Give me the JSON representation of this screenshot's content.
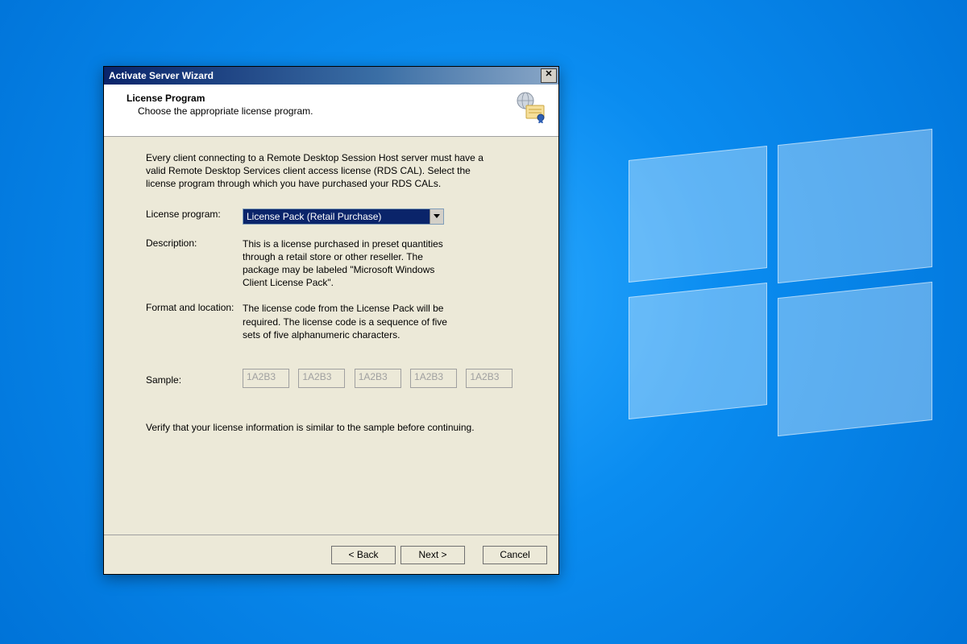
{
  "titlebar": {
    "title": "Activate Server Wizard",
    "close_glyph": "✕"
  },
  "header": {
    "heading": "License Program",
    "subheading": "Choose the appropriate license program."
  },
  "body": {
    "intro": "Every client connecting to a Remote Desktop Session Host server must have a valid Remote Desktop Services client access license (RDS CAL). Select the license program through which you have purchased your RDS CALs.",
    "license_program_label": "License program:",
    "license_program_value": "License Pack (Retail Purchase)",
    "description_label": "Description:",
    "description_value": "This is a license purchased in preset quantities through a retail store or other reseller. The package may be labeled \"Microsoft Windows Client License Pack\".",
    "format_label": "Format and location:",
    "format_value": "The license code from the License Pack will be required. The license code is a sequence of five sets of five alphanumeric characters.",
    "sample_label": "Sample:",
    "sample_placeholders": [
      "1A2B3",
      "1A2B3",
      "1A2B3",
      "1A2B3",
      "1A2B3"
    ],
    "verify_text": "Verify that your license information is similar to the sample before continuing."
  },
  "footer": {
    "back": "< Back",
    "next": "Next >",
    "cancel": "Cancel"
  }
}
